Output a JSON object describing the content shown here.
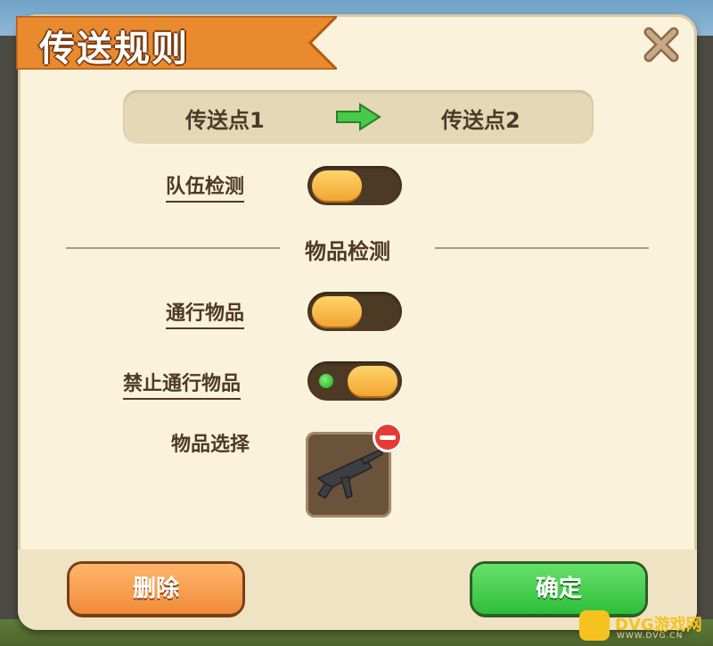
{
  "dialog": {
    "title": "传送规则",
    "close_icon": "close-x-icon"
  },
  "route": {
    "from": "传送点1",
    "to": "传送点2",
    "arrow_icon": "right-arrow-icon"
  },
  "settings": {
    "team_check": {
      "label": "队伍检测",
      "enabled": false
    },
    "section_title": "物品检测",
    "allowed_items": {
      "label": "通行物品",
      "enabled": false
    },
    "forbidden_items": {
      "label": "禁止通行物品",
      "enabled": true
    },
    "item_select": {
      "label": "物品选择",
      "item_icon": "submachine-gun-icon",
      "remove_icon": "remove-minus-icon"
    }
  },
  "footer": {
    "delete_label": "删除",
    "confirm_label": "确定"
  },
  "watermark": {
    "text": "DVG游戏网",
    "sub": "WWW.DVG.CN"
  },
  "colors": {
    "panel": "#fbf2dc",
    "accent_orange": "#f08c3a",
    "accent_green": "#2fbf3a",
    "text_brown": "#4d3a25"
  }
}
